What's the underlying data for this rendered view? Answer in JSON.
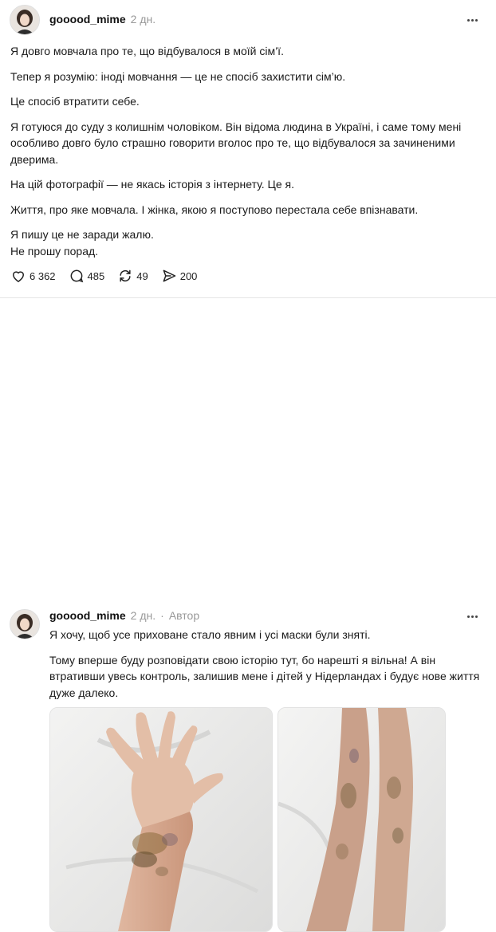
{
  "post": {
    "author": "gooood_mime",
    "time": "2 дн.",
    "paragraphs": [
      "Я довго мовчала про те, що відбувалося в моїй сім’ї.",
      "Тепер я розумію: іноді мовчання — це не спосіб захистити сім’ю.",
      "Це спосіб втратити себе.",
      "Я готуюся до суду з колишнім чоловіком. Він відома людина в Україні, і саме тому мені особливо довго було страшно говорити вголос про те, що відбувалося за зачиненими дверима.",
      "На цій фотографії — не якась історія з інтернету. Це я.",
      "Життя, про яке мовчала. І жінка, якою я поступово перестала себе впізнавати.",
      "Я пишу це не заради жалю.",
      "Не прошу порад."
    ],
    "likes": "6 362",
    "comments": "485",
    "reposts": "49",
    "shares": "200"
  },
  "reply": {
    "author": "gooood_mime",
    "time": "2 дн.",
    "author_badge": "Автор",
    "paragraphs": [
      "Я хочу, щоб усе приховане стало явним і усі маски були зняті.",
      "Тому вперше буду розповідати свою історію тут, бо нарешті я вільна! А він втративши увесь контроль, залишив мене і дітей у Нідерландах і будує нове життя дуже далеко."
    ]
  },
  "icons": {
    "like": "heart-icon",
    "comment": "speech-bubble-icon",
    "repost": "repost-arrows-icon",
    "share": "paper-plane-icon",
    "more": "more-dots-icon"
  }
}
